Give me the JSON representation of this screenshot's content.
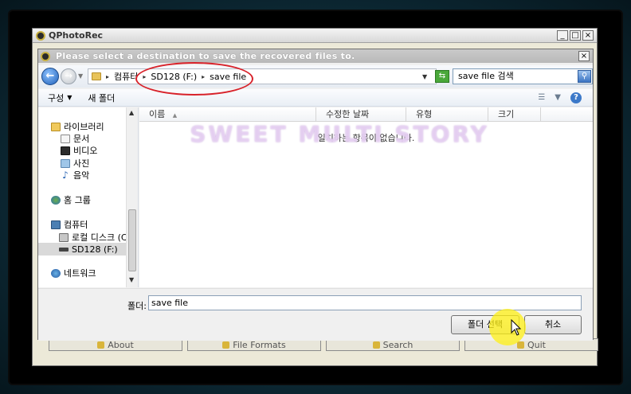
{
  "parent_window": {
    "title": "QPhotoRec",
    "btn_min": "_",
    "btn_max": "□",
    "btn_close": "×",
    "buttons": [
      "About",
      "File Formats",
      "Search",
      "Quit"
    ]
  },
  "dialog": {
    "title": "Please select a destination to save the recovered files to.",
    "close": "×",
    "address": {
      "crumbs": [
        "컴퓨터",
        "SD128 (F:)",
        "save file"
      ],
      "search_value": "save file 검색"
    },
    "toolbar": {
      "organize": "구성",
      "new_folder": "새 폴더",
      "help": "?"
    },
    "nav": {
      "items": [
        {
          "label": "라이브러리"
        },
        {
          "label": "문서"
        },
        {
          "label": "비디오"
        },
        {
          "label": "사진"
        },
        {
          "label": "음악"
        },
        {
          "label": "홈 그룹"
        },
        {
          "label": "컴퓨터"
        },
        {
          "label": "로컬 디스크 (C"
        },
        {
          "label": "SD128 (F:)"
        },
        {
          "label": "네트워크"
        }
      ]
    },
    "columns": [
      "이름",
      "수정한 날짜",
      "유형",
      "크기"
    ],
    "empty_message": "일치하는 항목이 없습니다.",
    "folder_label": "폴더:",
    "folder_value": "save file",
    "select_button": "폴더 선택",
    "cancel_button": "취소"
  },
  "watermark": "SWEET MULTI STORY",
  "colors": {
    "annotation_oval": "#d8222a",
    "highlight": "#fff014"
  }
}
